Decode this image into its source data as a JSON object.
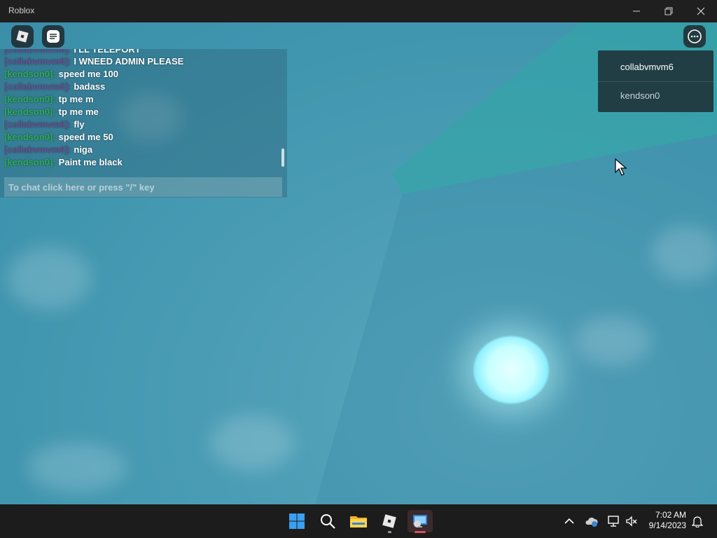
{
  "window": {
    "title": "Roblox"
  },
  "chat": {
    "messages": [
      {
        "name": "[collabvmvm6]:",
        "color": "purple",
        "text": "I WNEED ADMIN PLEASE"
      },
      {
        "name": "[kendson0]:",
        "color": "green",
        "text": "speed me 100"
      },
      {
        "name": "[collabvmvm6]:",
        "color": "purple",
        "text": "badass"
      },
      {
        "name": "[kendson0]:",
        "color": "green",
        "text": "tp me m"
      },
      {
        "name": "[kendson0]:",
        "color": "green",
        "text": "tp me me"
      },
      {
        "name": "[collabvmvm6]:",
        "color": "purple",
        "text": "fly"
      },
      {
        "name": "[kendson0]:",
        "color": "green",
        "text": "speed me 50"
      },
      {
        "name": "[collabvmvm6]:",
        "color": "purple",
        "text": "niga"
      },
      {
        "name": "[kendson0]:",
        "color": "green",
        "text": "Paint me black"
      }
    ],
    "input_placeholder": "To chat click here or press \"/\" key"
  },
  "players": [
    "collabvmvm6",
    "kendson0"
  ],
  "taskbar": {
    "icons": [
      "windows-start-icon",
      "search-icon",
      "file-explorer-icon",
      "roblox-icon",
      "remote-desktop-icon"
    ],
    "time": "7:02 AM",
    "date": "9/14/2023"
  },
  "colors": {
    "name_purple": "#6b4f8f",
    "name_green": "#2faa57",
    "sky": "#4b9db5"
  }
}
